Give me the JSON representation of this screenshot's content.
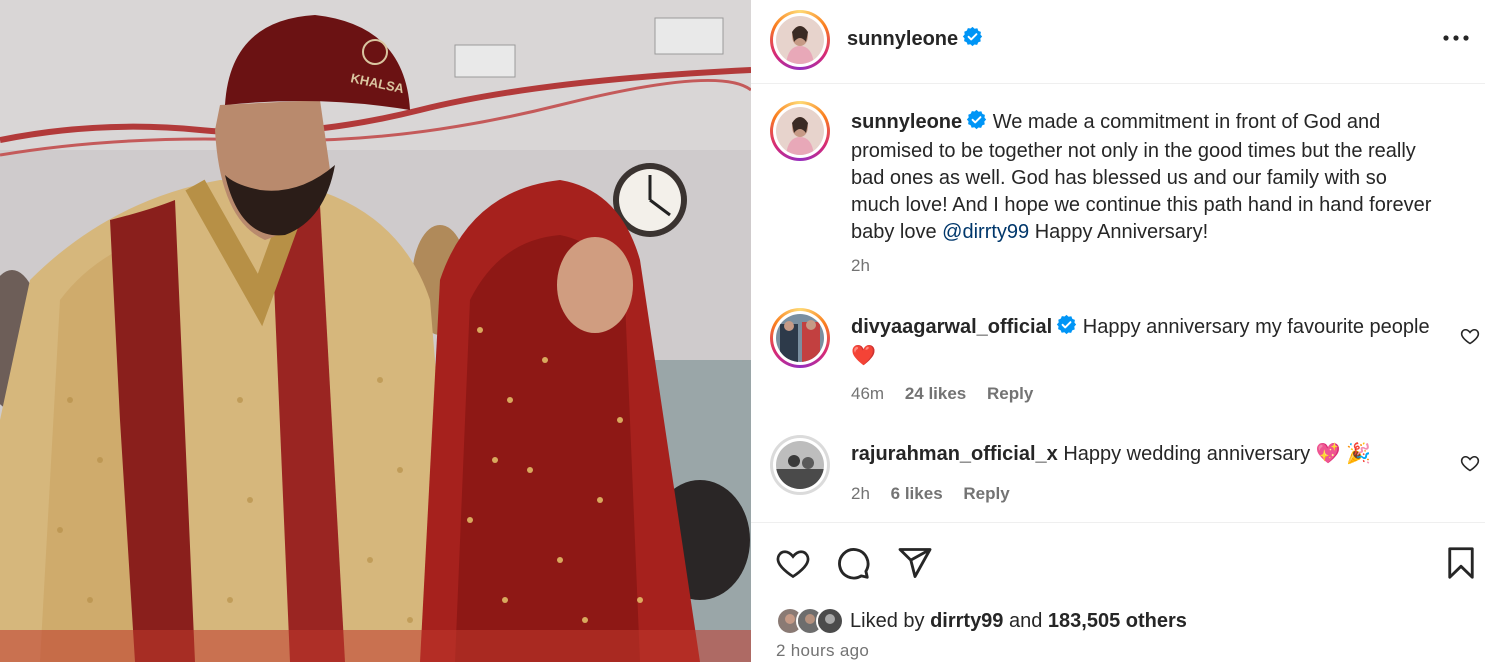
{
  "post": {
    "author": "sunnyleone",
    "verified": true,
    "image_alt": "Wedding photo"
  },
  "caption": {
    "username": "sunnyleone",
    "text_before": " We made a commitment in front of God and promised to be together not only in the good times but the really bad ones as well. God has blessed us and our family with so much love! And I hope we continue this path hand in hand forever baby love ",
    "mention": "@dirrty99",
    "text_after": " Happy Anniversary!",
    "time": "2h"
  },
  "comments": [
    {
      "username": "divyaagarwal_official",
      "verified": true,
      "text": "Happy anniversary my favourite people",
      "emoji": "❤️",
      "time": "46m",
      "likes": "24 likes",
      "reply": "Reply"
    },
    {
      "username": "rajurahman_official_x",
      "verified": false,
      "text": "Happy wedding anniversary",
      "emoji": "💖 🎉",
      "time": "2h",
      "likes": "6 likes",
      "reply": "Reply"
    }
  ],
  "likes": {
    "prefix": "Liked by ",
    "first_liker": "dirrty99",
    "middle": " and ",
    "others": "183,505 others"
  },
  "timestamp": "2 hours ago",
  "icons": {
    "like": "heart-icon",
    "comment": "comment-icon",
    "share": "share-icon",
    "save": "bookmark-icon",
    "more": "more-options-icon",
    "verified": "verified-badge-icon"
  },
  "colors": {
    "verified": "#0095f6",
    "mention": "#00376b",
    "secondary_text": "#737373",
    "heart_red": "#e0245e"
  }
}
